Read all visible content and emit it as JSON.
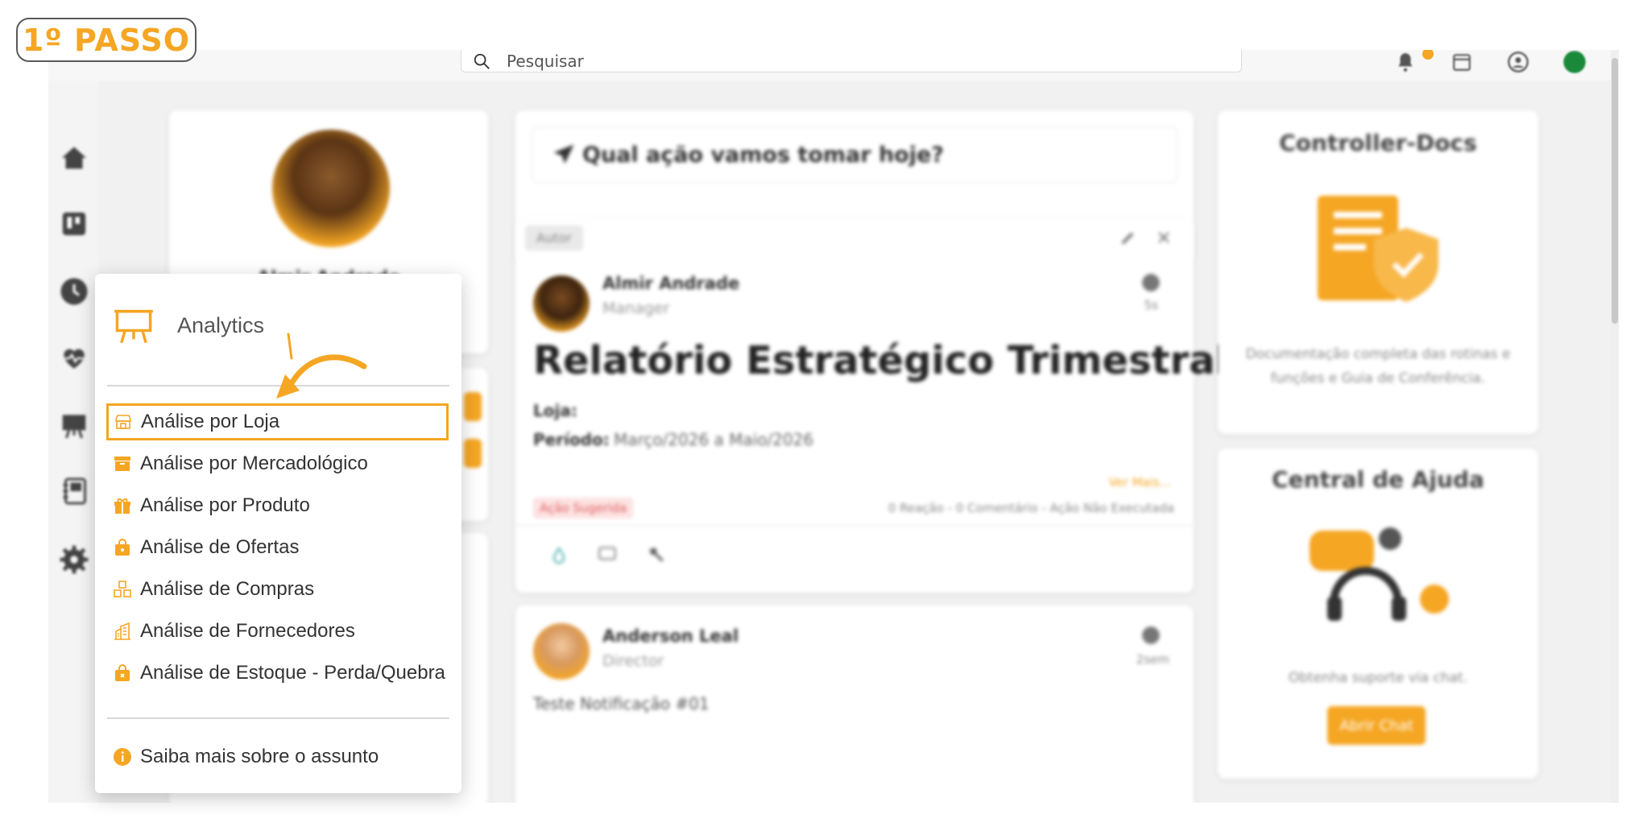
{
  "step_badge": "1º PASSO",
  "search": {
    "placeholder": "Pesquisar"
  },
  "profile": {
    "name": "Almir Andrade"
  },
  "feed": {
    "quick_action": "Qual ação vamos tomar hoje?",
    "post1": {
      "chip": "Autor",
      "author": "Almir Andrade",
      "role": "Manager",
      "time": "5s",
      "title": "Relatório Estratégico Trimestral",
      "store_label": "Loja:",
      "period_label": "Período:",
      "period_value": "Março/2026 a Maio/2026",
      "see_more": "Ver Mais...",
      "tag": "Ação Sugerida",
      "stats": "0 Reação - 0 Comentário - Ação Não Executada"
    },
    "post2": {
      "author": "Anderson Leal",
      "role": "Director",
      "time": "2sem",
      "text": "Teste Notificação #01"
    }
  },
  "right": {
    "docs_title": "Controller-Docs",
    "docs_text": "Documentação completa das rotinas e funções e Guia de Conferência.",
    "help_title": "Central de Ajuda",
    "help_text": "Obtenha suporte via chat.",
    "help_button": "Abrir Chat"
  },
  "menu": {
    "title": "Analytics",
    "items": [
      {
        "label": "Análise por Loja",
        "icon": "store-icon",
        "selected": true
      },
      {
        "label": "Análise por Mercadológico",
        "icon": "archive-icon"
      },
      {
        "label": "Análise por Produto",
        "icon": "gift-icon"
      },
      {
        "label": "Análise de Ofertas",
        "icon": "shopping-bag-icon"
      },
      {
        "label": "Análise de Compras",
        "icon": "boxes-icon"
      },
      {
        "label": "Análise de Fornecedores",
        "icon": "building-icon"
      },
      {
        "label": "Análise de Estoque - Perda/Quebra",
        "icon": "bag-x-icon"
      }
    ],
    "footer": "Saiba mais sobre o assunto"
  },
  "colors": {
    "accent": "#f5a623",
    "text": "#333333",
    "background": "#f1f1f1"
  }
}
